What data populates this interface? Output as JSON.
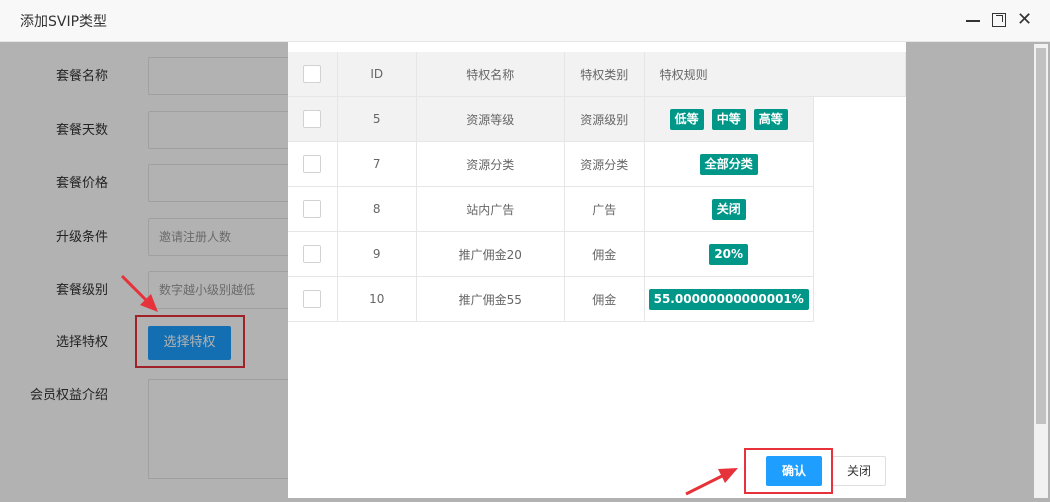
{
  "window": {
    "title": "添加SVIP类型",
    "close_glyph": "✕"
  },
  "form": {
    "package_name_label": "套餐名称",
    "package_days_label": "套餐天数",
    "package_price_label": "套餐价格",
    "upgrade_label": "升级条件",
    "upgrade_placeholder": "邀请注册人数",
    "level_label": "套餐级别",
    "level_placeholder": "数字越小级别越低",
    "privilege_label": "选择特权",
    "select_privilege_button": "选择特权",
    "intro_label": "会员权益介绍"
  },
  "privilege_table": {
    "headers": [
      "ID",
      "特权名称",
      "特权类别",
      "特权规则"
    ],
    "rows": [
      {
        "id": "5",
        "name": "资源等级",
        "category": "资源级别",
        "rules": [
          "低等",
          "中等",
          "高等"
        ]
      },
      {
        "id": "7",
        "name": "资源分类",
        "category": "资源分类",
        "rules": [
          "全部分类"
        ]
      },
      {
        "id": "8",
        "name": "站内广告",
        "category": "广告",
        "rules": [
          "关闭"
        ]
      },
      {
        "id": "9",
        "name": "推广佣金20",
        "category": "佣金",
        "rules": [
          "20%"
        ]
      },
      {
        "id": "10",
        "name": "推广佣金55",
        "category": "佣金",
        "rules": [
          "55.00000000000001%"
        ]
      }
    ]
  },
  "modal_buttons": {
    "confirm": "确认",
    "close": "关闭"
  },
  "colors": {
    "accent_blue": "#1e9fff",
    "tag_green": "#009688",
    "highlight_red": "#e6323a"
  }
}
